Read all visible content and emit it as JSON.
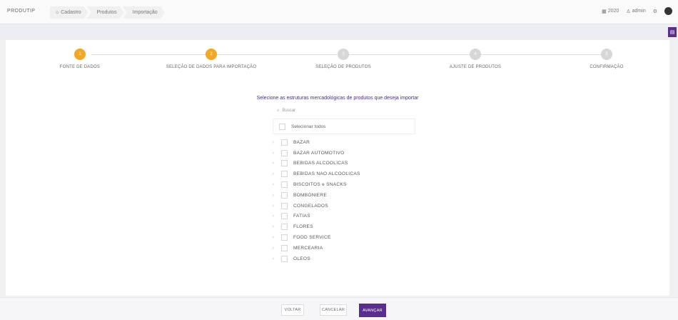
{
  "app": {
    "title": "PRODUTIP"
  },
  "breadcrumb": [
    {
      "label": "Cadastro",
      "icon": "home-icon"
    },
    {
      "label": "Produtos"
    },
    {
      "label": "Importação"
    }
  ],
  "topbar": {
    "date_label": "2020",
    "user_label": "admin"
  },
  "stepper": {
    "steps": [
      {
        "number": "1",
        "label": "FONTE DE DADOS",
        "state": "active"
      },
      {
        "number": "2",
        "label": "SELEÇÃO DE DADOS PARA IMPORTAÇÃO",
        "state": "active"
      },
      {
        "number": "3",
        "label": "SELEÇÃO DE PRODUTOS",
        "state": "inactive"
      },
      {
        "number": "4",
        "label": "AJUSTE DE PRODUTOS",
        "state": "inactive"
      },
      {
        "number": "5",
        "label": "CONFIRMAÇÃO",
        "state": "inactive"
      }
    ]
  },
  "main": {
    "prompt": "Selecione as estruturas mercadológicas de produtos que deseja importar",
    "search_placeholder": "Buscar",
    "select_all_label": "Selecionar todos",
    "categories": [
      "BAZAR",
      "BAZAR AUTOMOTIVO",
      "BEBIDAS ALCOOLICAS",
      "BEBIDAS NAO ALCOOLICAS",
      "BISCOITOS e SNACKS",
      "BOMBONIERE",
      "CONGELADOS",
      "FATIAS",
      "FLORES",
      "FOOD SERVICE",
      "MERCEARIA",
      "OLEOS"
    ]
  },
  "footer": {
    "back_label": "VOLTAR",
    "cancel_label": "CANCELAR",
    "next_label": "AVANÇAR"
  },
  "colors": {
    "accent": "#5b2d90",
    "step_active": "#f5a623",
    "step_inactive": "#d7d7d7"
  }
}
